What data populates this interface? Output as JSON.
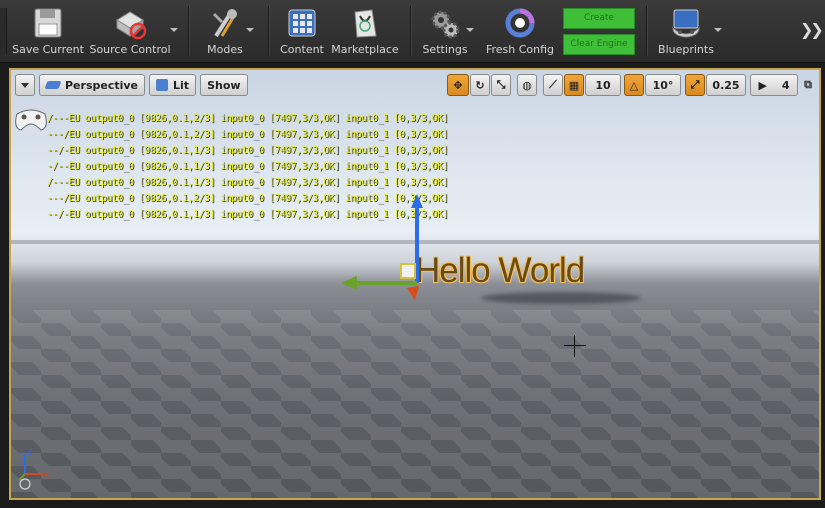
{
  "toolbar": {
    "buttons": [
      {
        "label": "Save Current",
        "icon": "floppy-disk-icon"
      },
      {
        "label": "Source Control",
        "icon": "source-control-disabled-icon"
      },
      {
        "label": "Modes",
        "icon": "modes-tools-icon"
      },
      {
        "label": "Content",
        "icon": "content-grid-icon"
      },
      {
        "label": "Marketplace",
        "icon": "marketplace-bag-icon"
      },
      {
        "label": "Settings",
        "icon": "settings-gears-icon"
      },
      {
        "label": "Fresh Config",
        "icon": "fresh-config-ring-icon"
      },
      {
        "label": "Blueprints",
        "icon": "blueprints-gamepad-icon"
      }
    ],
    "green_buttons": [
      "Create",
      "Clear Engine"
    ],
    "more_icon": "chevron-double-right-icon"
  },
  "viewport": {
    "perspective_label": "Perspective",
    "lit_label": "Lit",
    "show_label": "Show",
    "grid_snap_value": "10",
    "rotation_snap_value": "10°",
    "scale_snap_value": "0.25",
    "camera_speed_value": "4",
    "stats_lines": [
      "/---EU output0_0 [9826,0.1,2/3] input0_0 [7497,3/3,OK] input0_1 [0,3/3,OK]",
      "---/EU output0_0 [9826,0.1,2/3] input0_0 [7497,3/3,OK] input0_1 [0,3/3,OK]",
      "--/-EU output0_0 [9826,0.1,1/3] input0_0 [7497,3/3,OK] input0_1 [0,3/3,OK]",
      "-/--EU output0_0 [9826,0.1,1/3] input0_0 [7497,3/3,OK] input0_1 [0,3/3,OK]",
      "/---EU output0_0 [9826,0.1,1/3] input0_0 [7497,3/3,OK] input0_1 [0,3/3,OK]",
      "---/EU output0_0 [9826,0.1,2/3] input0_0 [7497,3/3,OK] input0_1 [0,3/3,OK]",
      "--/-EU output0_0 [9826,0.1,1/3] input0_0 [7497,3/3,OK] input0_1 [0,3/3,OK]"
    ],
    "hello_text": "Hello World",
    "axis_labels": [
      "Z",
      "X"
    ]
  },
  "colors": {
    "accent": "#caa64a",
    "stats_text": "#e6ef1a",
    "green_button": "#3fbf38",
    "orange_toggle": "#e29a2c"
  }
}
